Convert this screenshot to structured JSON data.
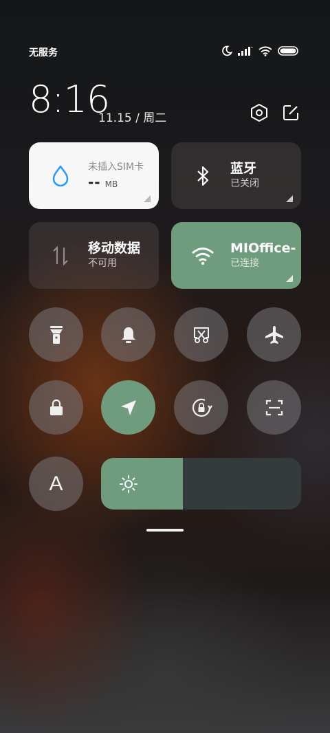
{
  "status_bar": {
    "carrier": "无服务",
    "icons": [
      "moon-icon",
      "signal-icon",
      "wifi-icon",
      "battery-icon"
    ]
  },
  "header": {
    "time": "8:16",
    "date": "11.15 / 周二",
    "settings_icon": "settings-icon",
    "edit_icon": "edit-icon"
  },
  "tiles": {
    "data_usage": {
      "title": "未插入SIM卡",
      "value": "--",
      "unit": "MB",
      "icon": "water-drop-icon"
    },
    "bluetooth": {
      "title": "蓝牙",
      "status": "已关闭",
      "icon": "bluetooth-icon"
    },
    "mobile_data": {
      "title": "移动数据",
      "status": "不可用",
      "icon": "data-arrows-icon"
    },
    "wifi": {
      "title": "MIOffice-",
      "status": "已连接",
      "icon": "wifi-icon"
    }
  },
  "toggles": [
    {
      "name": "flashlight",
      "icon": "flashlight-icon",
      "active": false
    },
    {
      "name": "ring",
      "icon": "bell-icon",
      "active": false
    },
    {
      "name": "screenshot",
      "icon": "screenshot-icon",
      "active": false
    },
    {
      "name": "airplane",
      "icon": "airplane-icon",
      "active": false
    },
    {
      "name": "lock-screen",
      "icon": "lock-icon",
      "active": false
    },
    {
      "name": "location",
      "icon": "location-icon",
      "active": true
    },
    {
      "name": "auto-rotate",
      "icon": "rotate-lock-icon",
      "active": false
    },
    {
      "name": "scanner",
      "icon": "scan-icon",
      "active": false
    },
    {
      "name": "font-size",
      "icon": "font-icon",
      "label": "A",
      "active": false
    }
  ],
  "brightness": {
    "level": 0.41,
    "icon": "sun-icon"
  },
  "colors": {
    "accent": "#6f9c7d",
    "tile_dark": "#4a4446",
    "tile_white": "#f7f7f7"
  }
}
